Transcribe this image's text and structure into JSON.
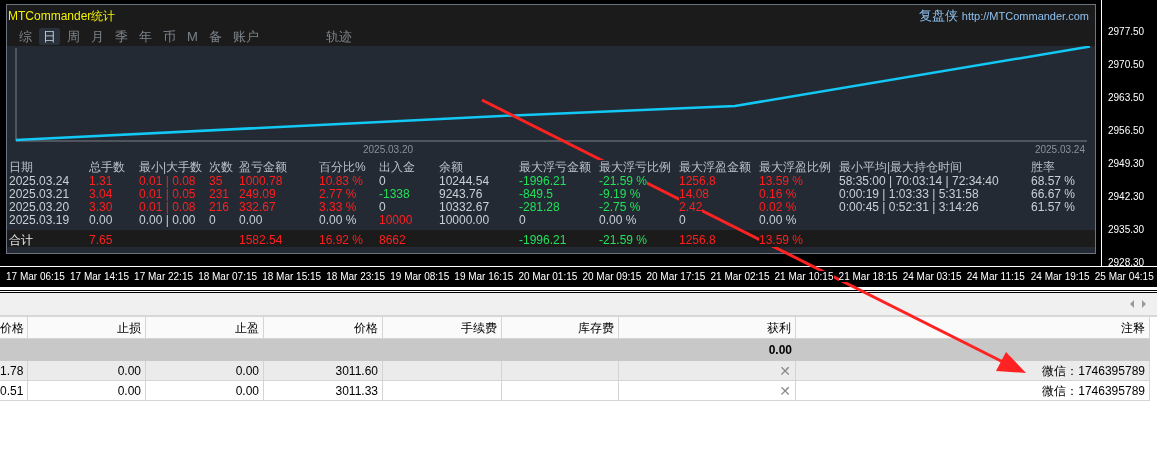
{
  "panel": {
    "title": "MTCommander统计",
    "brand": "复盘侠",
    "url": "http://MTCommander.com",
    "tabs": [
      {
        "label": "综",
        "selected": false
      },
      {
        "label": "日",
        "selected": true
      },
      {
        "label": "周",
        "selected": false
      },
      {
        "label": "月",
        "selected": false
      },
      {
        "label": "季",
        "selected": false
      },
      {
        "label": "年",
        "selected": false
      },
      {
        "label": "币",
        "selected": false
      },
      {
        "label": "M",
        "selected": false
      },
      {
        "label": "备",
        "selected": false
      },
      {
        "label": "账户",
        "selected": false
      }
    ],
    "extra_tab": {
      "label": "轨迹",
      "selected": false
    },
    "chart_dates": [
      "2025.03.20",
      "2025.03.24"
    ],
    "stats": {
      "columns": [
        "日期",
        "总手数",
        "最小|大手数",
        "次数",
        "盈亏金额",
        "百分比%",
        "出入金",
        "余额",
        "最大浮亏金额",
        "最大浮亏比例",
        "最大浮盈金额",
        "最大浮盈比例",
        "最小平均|最大持仓时间",
        "胜率"
      ],
      "rows": [
        [
          {
            "text": "2025.03.24",
            "color": "#c8d0d8"
          },
          {
            "text": "1.31",
            "color": "#ff1f1f"
          },
          {
            "text": "0.01 | 0.08",
            "color": "#ff1f1f"
          },
          {
            "text": "35",
            "color": "#ff1f1f"
          },
          {
            "text": "1000.78",
            "color": "#ff1f1f"
          },
          {
            "text": "10.83 %",
            "color": "#ff1f1f"
          },
          {
            "text": "0",
            "color": "#c8d0d8"
          },
          {
            "text": "10244.54",
            "color": "#c8d0d8"
          },
          {
            "text": "-1996.21",
            "color": "#22e05a"
          },
          {
            "text": "-21.59 %",
            "color": "#22e05a"
          },
          {
            "text": "1256.8",
            "color": "#ff1f1f"
          },
          {
            "text": "13.59 %",
            "color": "#ff1f1f"
          },
          {
            "text": "58:35:00 | 70:03:14 | 72:34:40",
            "color": "#c8d0d8"
          },
          {
            "text": "68.57 %",
            "color": "#c8d0d8"
          }
        ],
        [
          {
            "text": "2025.03.21",
            "color": "#c8d0d8"
          },
          {
            "text": "3.04",
            "color": "#ff1f1f"
          },
          {
            "text": "0.01 | 0.05",
            "color": "#ff1f1f"
          },
          {
            "text": "231",
            "color": "#ff1f1f"
          },
          {
            "text": "249.09",
            "color": "#ff1f1f"
          },
          {
            "text": "2.77 %",
            "color": "#ff1f1f"
          },
          {
            "text": "-1338",
            "color": "#22e05a"
          },
          {
            "text": "9243.76",
            "color": "#c8d0d8"
          },
          {
            "text": "-849.5",
            "color": "#22e05a"
          },
          {
            "text": "-9.19 %",
            "color": "#22e05a"
          },
          {
            "text": "14.08",
            "color": "#ff1f1f"
          },
          {
            "text": "0.16 %",
            "color": "#ff1f1f"
          },
          {
            "text": "0:00:19 | 1:03:33 | 5:31:58",
            "color": "#c8d0d8"
          },
          {
            "text": "66.67 %",
            "color": "#c8d0d8"
          }
        ],
        [
          {
            "text": "2025.03.20",
            "color": "#c8d0d8"
          },
          {
            "text": "3.30",
            "color": "#ff1f1f"
          },
          {
            "text": "0.01 | 0.08",
            "color": "#ff1f1f"
          },
          {
            "text": "216",
            "color": "#ff1f1f"
          },
          {
            "text": "332.67",
            "color": "#ff1f1f"
          },
          {
            "text": "3.33 %",
            "color": "#ff1f1f"
          },
          {
            "text": "0",
            "color": "#c8d0d8"
          },
          {
            "text": "10332.67",
            "color": "#c8d0d8"
          },
          {
            "text": "-281.28",
            "color": "#22e05a"
          },
          {
            "text": "-2.75 %",
            "color": "#22e05a"
          },
          {
            "text": "2.42",
            "color": "#ff1f1f"
          },
          {
            "text": "0.02 %",
            "color": "#ff1f1f"
          },
          {
            "text": "0:00:45 | 0:52:31 | 3:14:26",
            "color": "#c8d0d8"
          },
          {
            "text": "61.57 %",
            "color": "#c8d0d8"
          }
        ],
        [
          {
            "text": "2025.03.19",
            "color": "#c8d0d8"
          },
          {
            "text": "0.00",
            "color": "#c8d0d8"
          },
          {
            "text": "0.00 | 0.00",
            "color": "#c8d0d8"
          },
          {
            "text": "0",
            "color": "#c8d0d8"
          },
          {
            "text": "0.00",
            "color": "#c8d0d8"
          },
          {
            "text": "0.00 %",
            "color": "#c8d0d8"
          },
          {
            "text": "10000",
            "color": "#ff1f1f"
          },
          {
            "text": "10000.00",
            "color": "#c8d0d8"
          },
          {
            "text": "0",
            "color": "#c8d0d8"
          },
          {
            "text": "0.00 %",
            "color": "#c8d0d8"
          },
          {
            "text": "0",
            "color": "#c8d0d8"
          },
          {
            "text": "0.00 %",
            "color": "#c8d0d8"
          }
        ]
      ],
      "total": {
        "label": "合计",
        "lots": {
          "text": "7.65",
          "color": "#ff1f1f"
        },
        "pnl": {
          "text": "1582.54",
          "color": "#ff1f1f"
        },
        "percent": {
          "text": "16.92 %",
          "color": "#ff1f1f"
        },
        "deposit": {
          "text": "8662",
          "color": "#ff1f1f"
        },
        "max_float_loss": {
          "text": "-1996.21",
          "color": "#22e05a"
        },
        "max_float_loss_pct": {
          "text": "-21.59 %",
          "color": "#22e05a"
        },
        "max_float_gain": {
          "text": "1256.8",
          "color": "#ff1f1f"
        },
        "max_float_gain_pct": {
          "text": "13.59 %",
          "color": "#ff1f1f"
        }
      }
    }
  },
  "price_axis": [
    "2977.50",
    "2970.50",
    "2963.50",
    "2956.50",
    "2949.30",
    "2942.30",
    "2935.30",
    "2928.30"
  ],
  "time_axis": [
    "17 Mar 06:15",
    "17 Mar 14:15",
    "17 Mar 22:15",
    "18 Mar 07:15",
    "18 Mar 15:15",
    "18 Mar 23:15",
    "19 Mar 08:15",
    "19 Mar 16:15",
    "20 Mar 01:15",
    "20 Mar 09:15",
    "20 Mar 17:15",
    "21 Mar 02:15",
    "21 Mar 10:15",
    "21 Mar 18:15",
    "24 Mar 03:15",
    "24 Mar 11:15",
    "24 Mar 19:15",
    "25 Mar 04:15"
  ],
  "orders": {
    "columns": [
      "价格",
      "止损",
      "止盈",
      "价格",
      "手续费",
      "库存费",
      "获利",
      "注释"
    ],
    "total": {
      "profit": "0.00"
    },
    "rows": [
      {
        "cells": [
          "1.78",
          "0.00",
          "0.00",
          "3011.60",
          "",
          "",
          "✕",
          "微信：1746395789"
        ]
      },
      {
        "cells": [
          "0.51",
          "0.00",
          "0.00",
          "3011.33",
          "",
          "",
          "✕",
          "微信：1746395789"
        ]
      }
    ]
  }
}
